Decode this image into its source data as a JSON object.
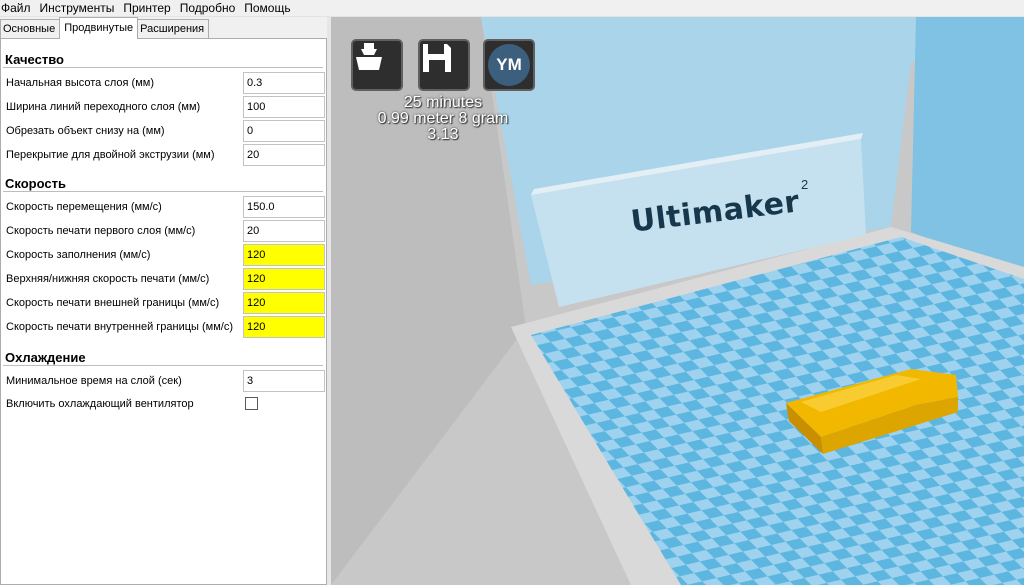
{
  "menu": [
    "Файл",
    "Инструменты",
    "Принтер",
    "Подробно",
    "Помощь"
  ],
  "tabs": [
    {
      "label": "Основные",
      "active": false
    },
    {
      "label": "Продвинутые",
      "active": true
    },
    {
      "label": "Расширения",
      "active": false
    }
  ],
  "sections": {
    "quality": {
      "title": "Качество",
      "rows": [
        {
          "label": "Начальная высота слоя (мм)",
          "value": "0.3"
        },
        {
          "label": "Ширина линий переходного слоя (мм)",
          "value": "100"
        },
        {
          "label": "Обрезать объект снизу на (мм)",
          "value": "0"
        },
        {
          "label": "Перекрытие для двойной экструзии (мм)",
          "value": "20"
        }
      ]
    },
    "speed": {
      "title": "Скорость",
      "rows": [
        {
          "label": "Скорость перемещения (мм/с)",
          "value": "150.0",
          "highlight": false
        },
        {
          "label": "Скорость печати первого слоя (мм/с)",
          "value": "20",
          "highlight": false
        },
        {
          "label": "Скорость заполнения (мм/с)",
          "value": "120",
          "highlight": true
        },
        {
          "label": "Верхняя/нижняя скорость печати (мм/с)",
          "value": "120",
          "highlight": true
        },
        {
          "label": "Скорость печати внешней границы (мм/с)",
          "value": "120",
          "highlight": true
        },
        {
          "label": "Скорость печати внутренней границы (мм/с)",
          "value": "120",
          "highlight": true
        }
      ]
    },
    "cooling": {
      "title": "Охлаждение",
      "rows": [
        {
          "label": "Минимальное время на слой (сек)",
          "value": "3"
        },
        {
          "label": "Включить охлаждающий вентилятор",
          "checked": false
        }
      ]
    }
  },
  "viewport": {
    "buttons": {
      "load_icon": "load-model-icon",
      "save_icon": "save-floppy-icon",
      "ym_label": "YM"
    },
    "info": {
      "time": "25 minutes",
      "material": "0.99 meter 8 gram",
      "cost": "3.13"
    },
    "brand": "Ultimaker",
    "brand_sup": "2",
    "colors": {
      "grid_light": "#9fd2ee",
      "grid_dark": "#5cb6e0",
      "model": "#f2b800",
      "highlight": "#ffff00"
    }
  }
}
